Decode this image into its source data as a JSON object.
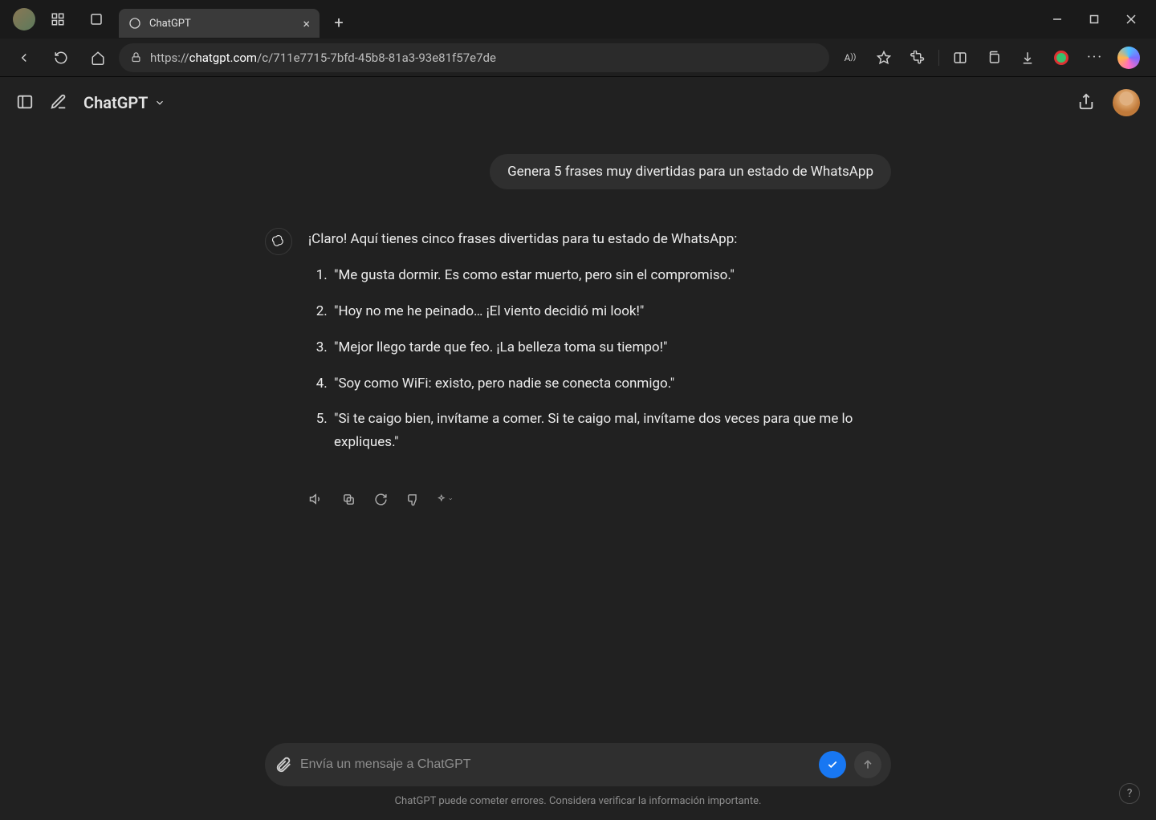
{
  "browser": {
    "tab_title": "ChatGPT",
    "url_prefix": "https://",
    "url_host": "chatgpt.com",
    "url_path": "/c/711e7715-7bfd-45b8-81a3-93e81f57e7de"
  },
  "app": {
    "title": "ChatGPT"
  },
  "conversation": {
    "user_message": "Genera 5 frases muy divertidas para un estado de WhatsApp",
    "assistant_intro": "¡Claro! Aquí tienes cinco frases divertidas para tu estado de WhatsApp:",
    "items": [
      "\"Me gusta dormir. Es como estar muerto, pero sin el compromiso.\"",
      "\"Hoy no me he peinado… ¡El viento decidió mi look!\"",
      "\"Mejor llego tarde que feo. ¡La belleza toma su tiempo!\"",
      "\"Soy como WiFi: existo, pero nadie se conecta conmigo.\"",
      "\"Si te caigo bien, invítame a comer. Si te caigo mal, invítame dos veces para que me lo expliques.\""
    ]
  },
  "input": {
    "placeholder": "Envía un mensaje a ChatGPT"
  },
  "footer": {
    "disclaimer": "ChatGPT puede cometer errores. Considera verificar la información importante."
  },
  "help": {
    "label": "?"
  }
}
